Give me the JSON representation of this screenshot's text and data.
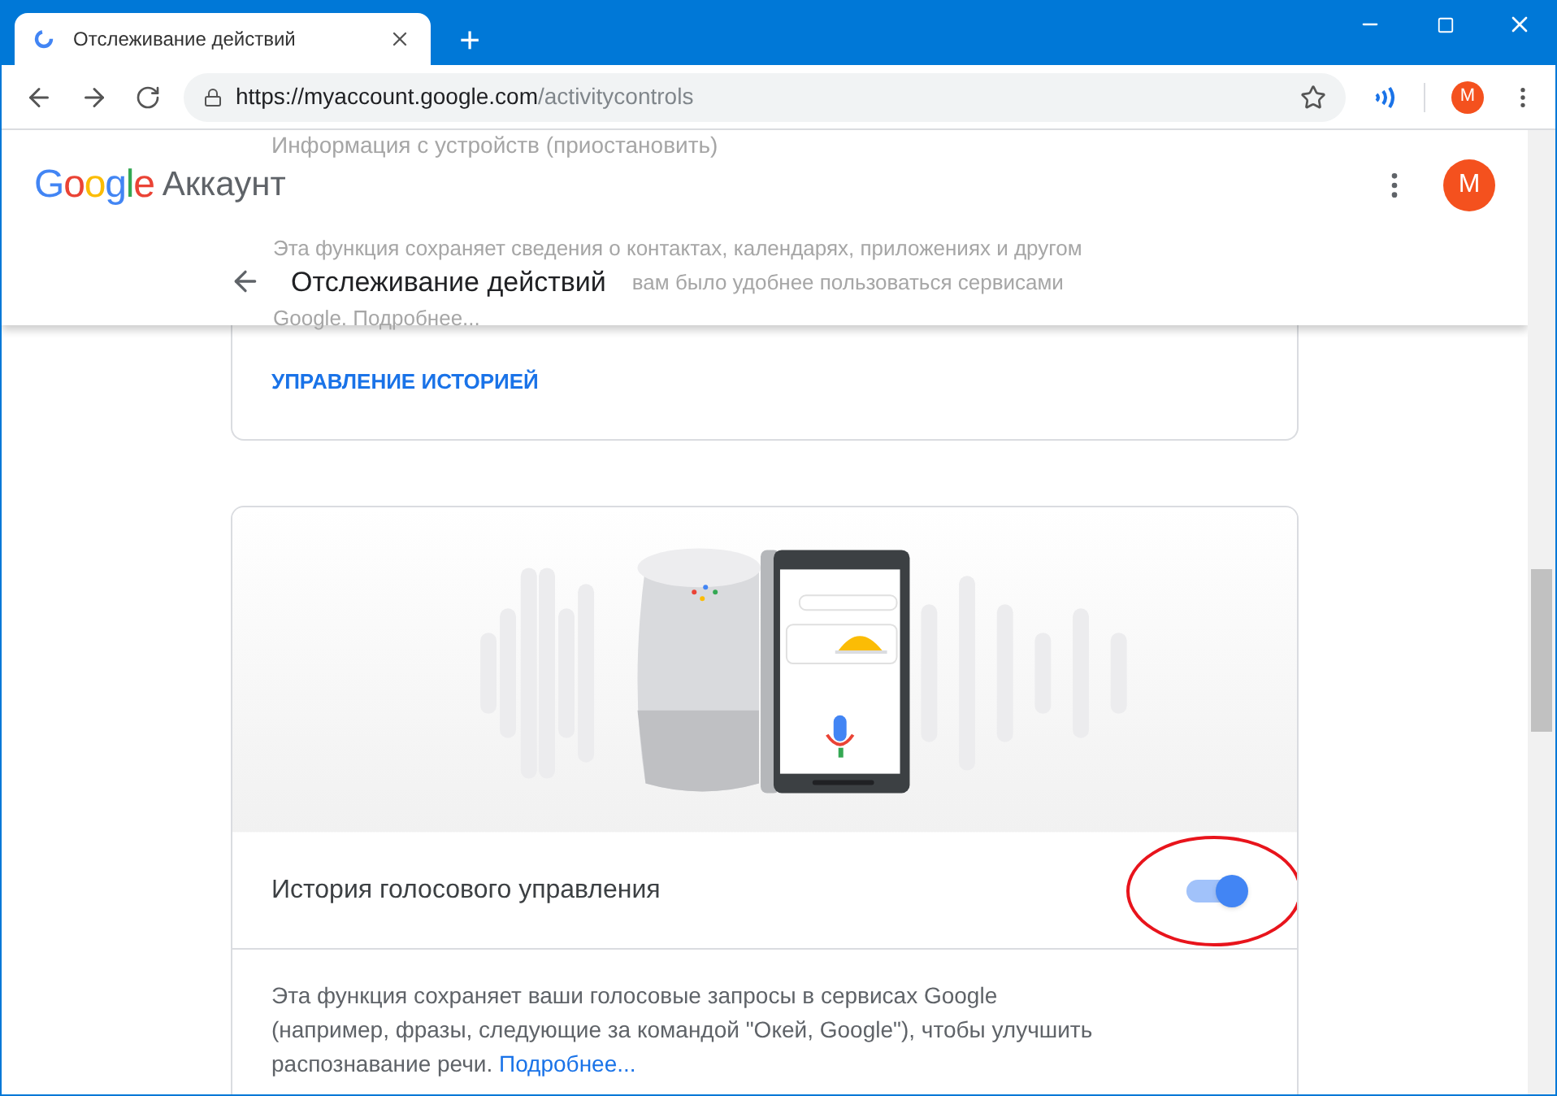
{
  "browser": {
    "tab_title": "Отслеживание действий",
    "new_tab": "+",
    "url_host": "https://myaccount.google.com",
    "url_path": "/activitycontrols",
    "profile_initial": "M"
  },
  "header": {
    "logo": "Google",
    "product": "Аккаунт",
    "avatar_initial": "M",
    "page_title": "Отслеживание действий",
    "faded_lines": [
      "Информация с устройств (приостановить)",
      "Эта функция сохраняет сведения о контактах, календарях, приложениях и другом",
      "вам было удобнее пользоваться сервисами",
      "Google. Подробнее..."
    ]
  },
  "history_card": {
    "link": "УПРАВЛЕНИЕ ИСТОРИЕЙ"
  },
  "voice_card": {
    "title": "История голосового управления",
    "on": true,
    "description": "Эта функция сохраняет ваши голосовые запросы в сервисах Google (например, фразы, следующие за командой \"Окей, Google\"), чтобы улучшить распознавание речи.",
    "more_link": "Подробнее..."
  }
}
